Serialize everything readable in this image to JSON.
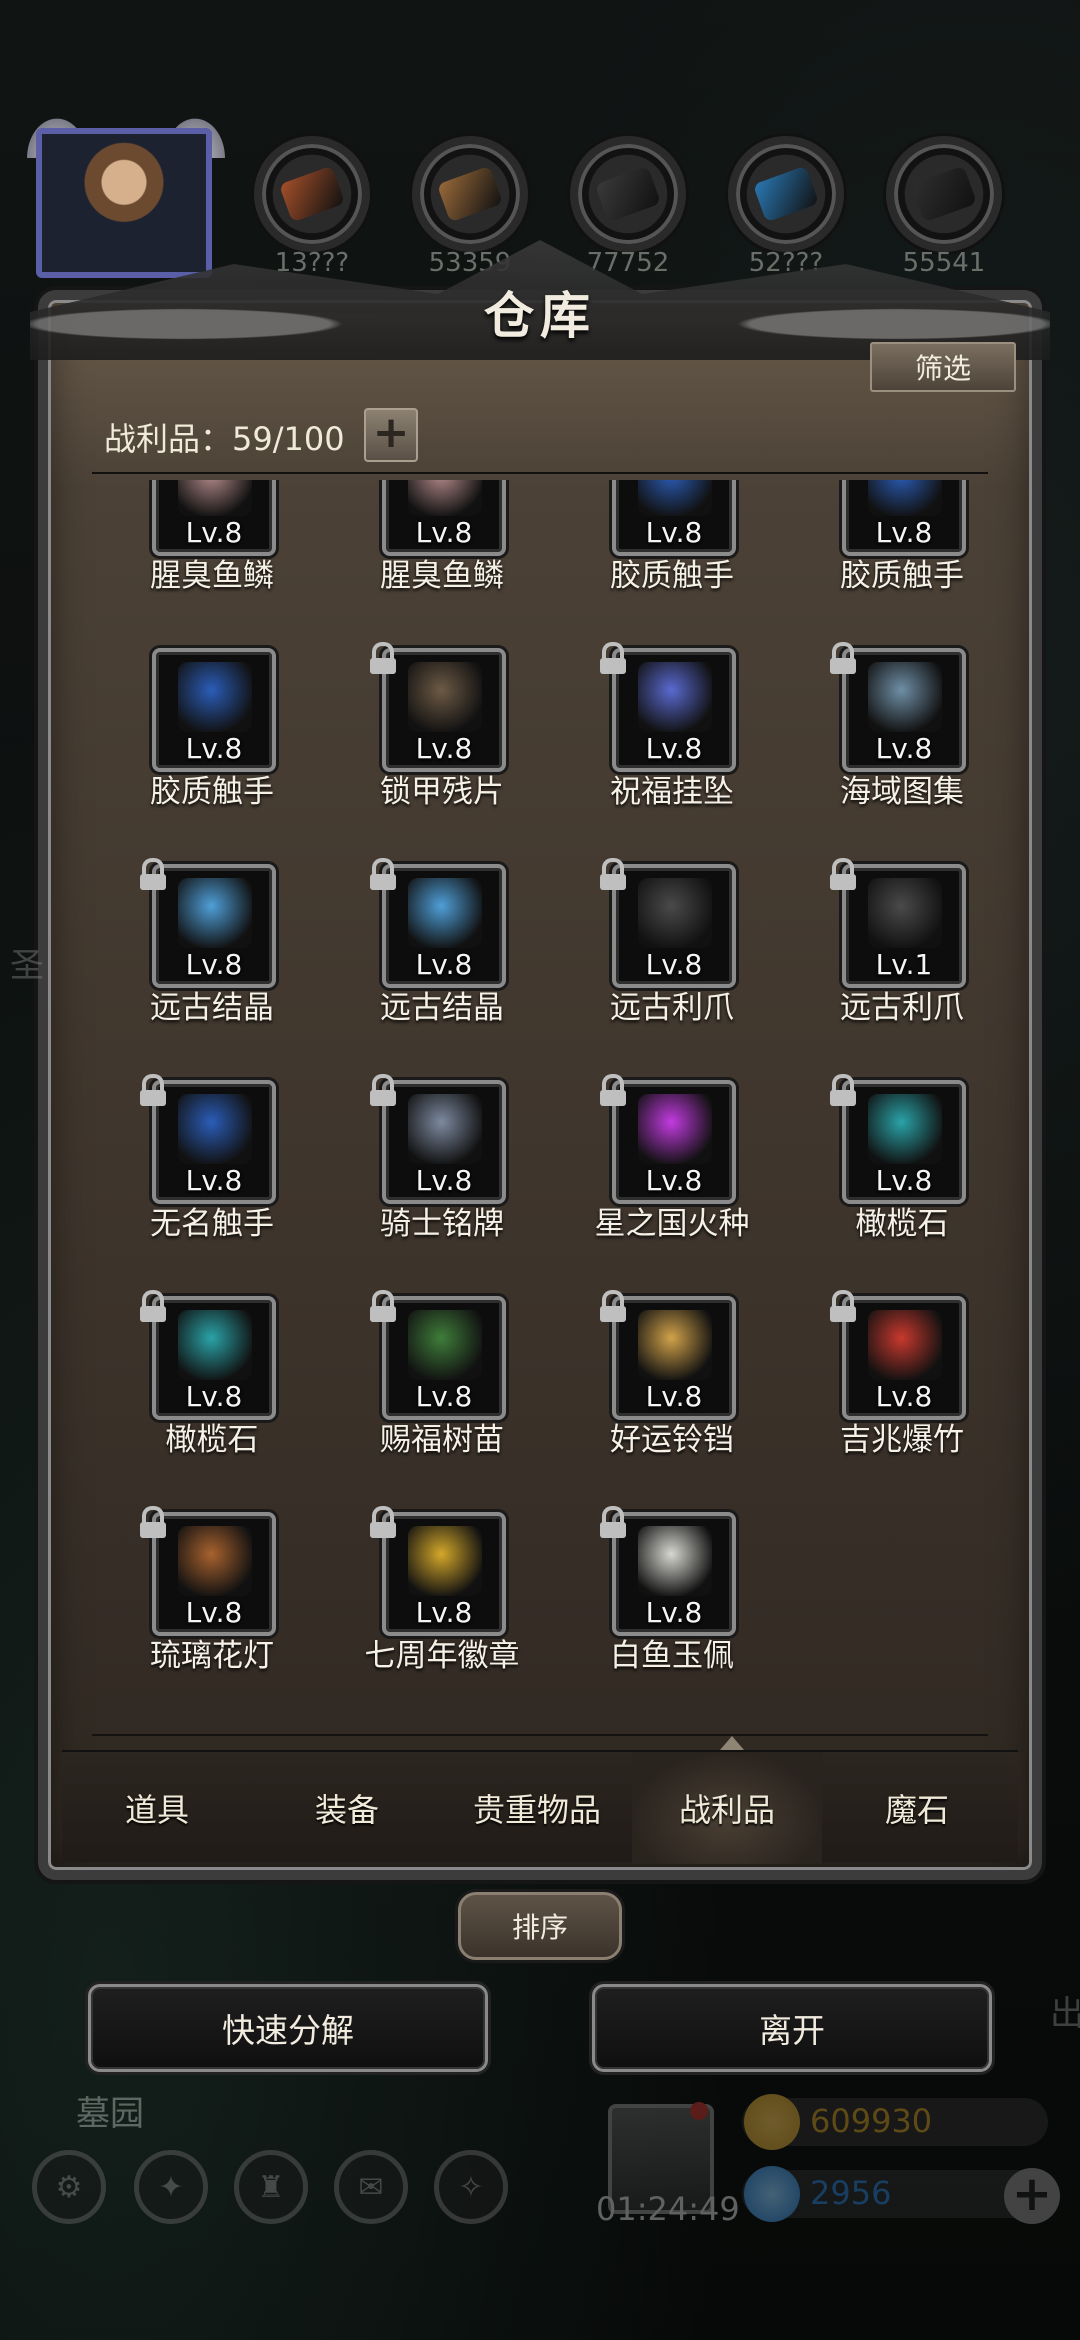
{
  "hud": {
    "resources": [
      {
        "icon": "ore-copper-icon",
        "color": "#a5502a",
        "count": "13???"
      },
      {
        "icon": "wood-plank-icon",
        "color": "#9a6a3a",
        "count": "53359"
      },
      {
        "icon": "iron-ingot-icon",
        "color": "#3a3a3a",
        "count": "77752"
      },
      {
        "icon": "crystal-shard-icon",
        "color": "#2a79b5",
        "count": "52???"
      },
      {
        "icon": "black-ore-icon",
        "color": "#2e2e2e",
        "count": "55541"
      }
    ]
  },
  "warehouse": {
    "title": "仓库",
    "filter_label": "筛选",
    "capacity_label": "战利品：59/100",
    "add_label": "+"
  },
  "items": [
    {
      "level": "Lv.8",
      "name": "腥臭鱼鳞",
      "locked": false,
      "icon": "fish-scale-icon",
      "color": "#b48a8a"
    },
    {
      "level": "Lv.8",
      "name": "腥臭鱼鳞",
      "locked": false,
      "icon": "fish-scale-icon",
      "color": "#b48a8a"
    },
    {
      "level": "Lv.8",
      "name": "胶质触手",
      "locked": false,
      "icon": "tentacle-icon",
      "color": "#2b5db8"
    },
    {
      "level": "Lv.8",
      "name": "胶质触手",
      "locked": false,
      "icon": "tentacle-icon",
      "color": "#2b5db8"
    },
    {
      "level": "Lv.8",
      "name": "胶质触手",
      "locked": false,
      "icon": "tentacle-icon",
      "color": "#2b5db8"
    },
    {
      "level": "Lv.8",
      "name": "锁甲残片",
      "locked": true,
      "icon": "chainmail-fragment-icon",
      "color": "#6d5a45"
    },
    {
      "level": "Lv.8",
      "name": "祝福挂坠",
      "locked": true,
      "icon": "pendant-icon",
      "color": "#5a6ad0"
    },
    {
      "level": "Lv.8",
      "name": "海域图集",
      "locked": true,
      "icon": "sea-atlas-icon",
      "color": "#6f8fa6"
    },
    {
      "level": "Lv.8",
      "name": "远古结晶",
      "locked": true,
      "icon": "ancient-crystal-icon",
      "color": "#4f9fd8"
    },
    {
      "level": "Lv.8",
      "name": "远古结晶",
      "locked": true,
      "icon": "ancient-crystal-icon",
      "color": "#4f9fd8"
    },
    {
      "level": "Lv.8",
      "name": "远古利爪",
      "locked": true,
      "icon": "ancient-claw-icon",
      "color": "#4a4a4a"
    },
    {
      "level": "Lv.1",
      "name": "远古利爪",
      "locked": true,
      "icon": "ancient-claw-icon",
      "color": "#4a4a4a"
    },
    {
      "level": "Lv.8",
      "name": "无名触手",
      "locked": true,
      "icon": "tentacle-icon",
      "color": "#2b5db8"
    },
    {
      "level": "Lv.8",
      "name": "骑士铭牌",
      "locked": true,
      "icon": "knight-badge-icon",
      "color": "#7d8aa0"
    },
    {
      "level": "Lv.8",
      "name": "星之国火种",
      "locked": true,
      "icon": "star-kindling-icon",
      "color": "#c23be0"
    },
    {
      "level": "Lv.8",
      "name": "橄榄石",
      "locked": true,
      "icon": "olivine-gem-icon",
      "color": "#2aa3a8"
    },
    {
      "level": "Lv.8",
      "name": "橄榄石",
      "locked": true,
      "icon": "olivine-gem-icon",
      "color": "#2aa3a8"
    },
    {
      "level": "Lv.8",
      "name": "赐福树苗",
      "locked": true,
      "icon": "blessing-sapling-icon",
      "color": "#3f7d3a"
    },
    {
      "level": "Lv.8",
      "name": "好运铃铛",
      "locked": true,
      "icon": "lucky-bell-icon",
      "color": "#d1a24a"
    },
    {
      "level": "Lv.8",
      "name": "吉兆爆竹",
      "locked": true,
      "icon": "firecracker-icon",
      "color": "#c8392e"
    },
    {
      "level": "Lv.8",
      "name": "琉璃花灯",
      "locked": true,
      "icon": "glass-lantern-icon",
      "color": "#a8622e"
    },
    {
      "level": "Lv.8",
      "name": "七周年徽章",
      "locked": true,
      "icon": "anniversary-badge-icon",
      "color": "#d4a82a"
    },
    {
      "level": "Lv.8",
      "name": "白鱼玉佩",
      "locked": true,
      "icon": "jade-fish-pendant-icon",
      "color": "#d8d8d2"
    }
  ],
  "tabs": [
    {
      "label": "道具",
      "active": false
    },
    {
      "label": "装备",
      "active": false
    },
    {
      "label": "贵重物品",
      "active": false
    },
    {
      "label": "战利品",
      "active": true
    },
    {
      "label": "魔石",
      "active": false
    }
  ],
  "actions": {
    "sort_label": "排序",
    "quick_decompose_label": "快速分解",
    "leave_label": "离开"
  },
  "bottom_hud": {
    "area_name": "墓园",
    "timer": "01:24:49",
    "gold": "609930",
    "gems": "2956",
    "gold_color": "#c89a2a",
    "gem_color": "#2f7fd0",
    "side_left": "圣",
    "side_right": "出"
  }
}
